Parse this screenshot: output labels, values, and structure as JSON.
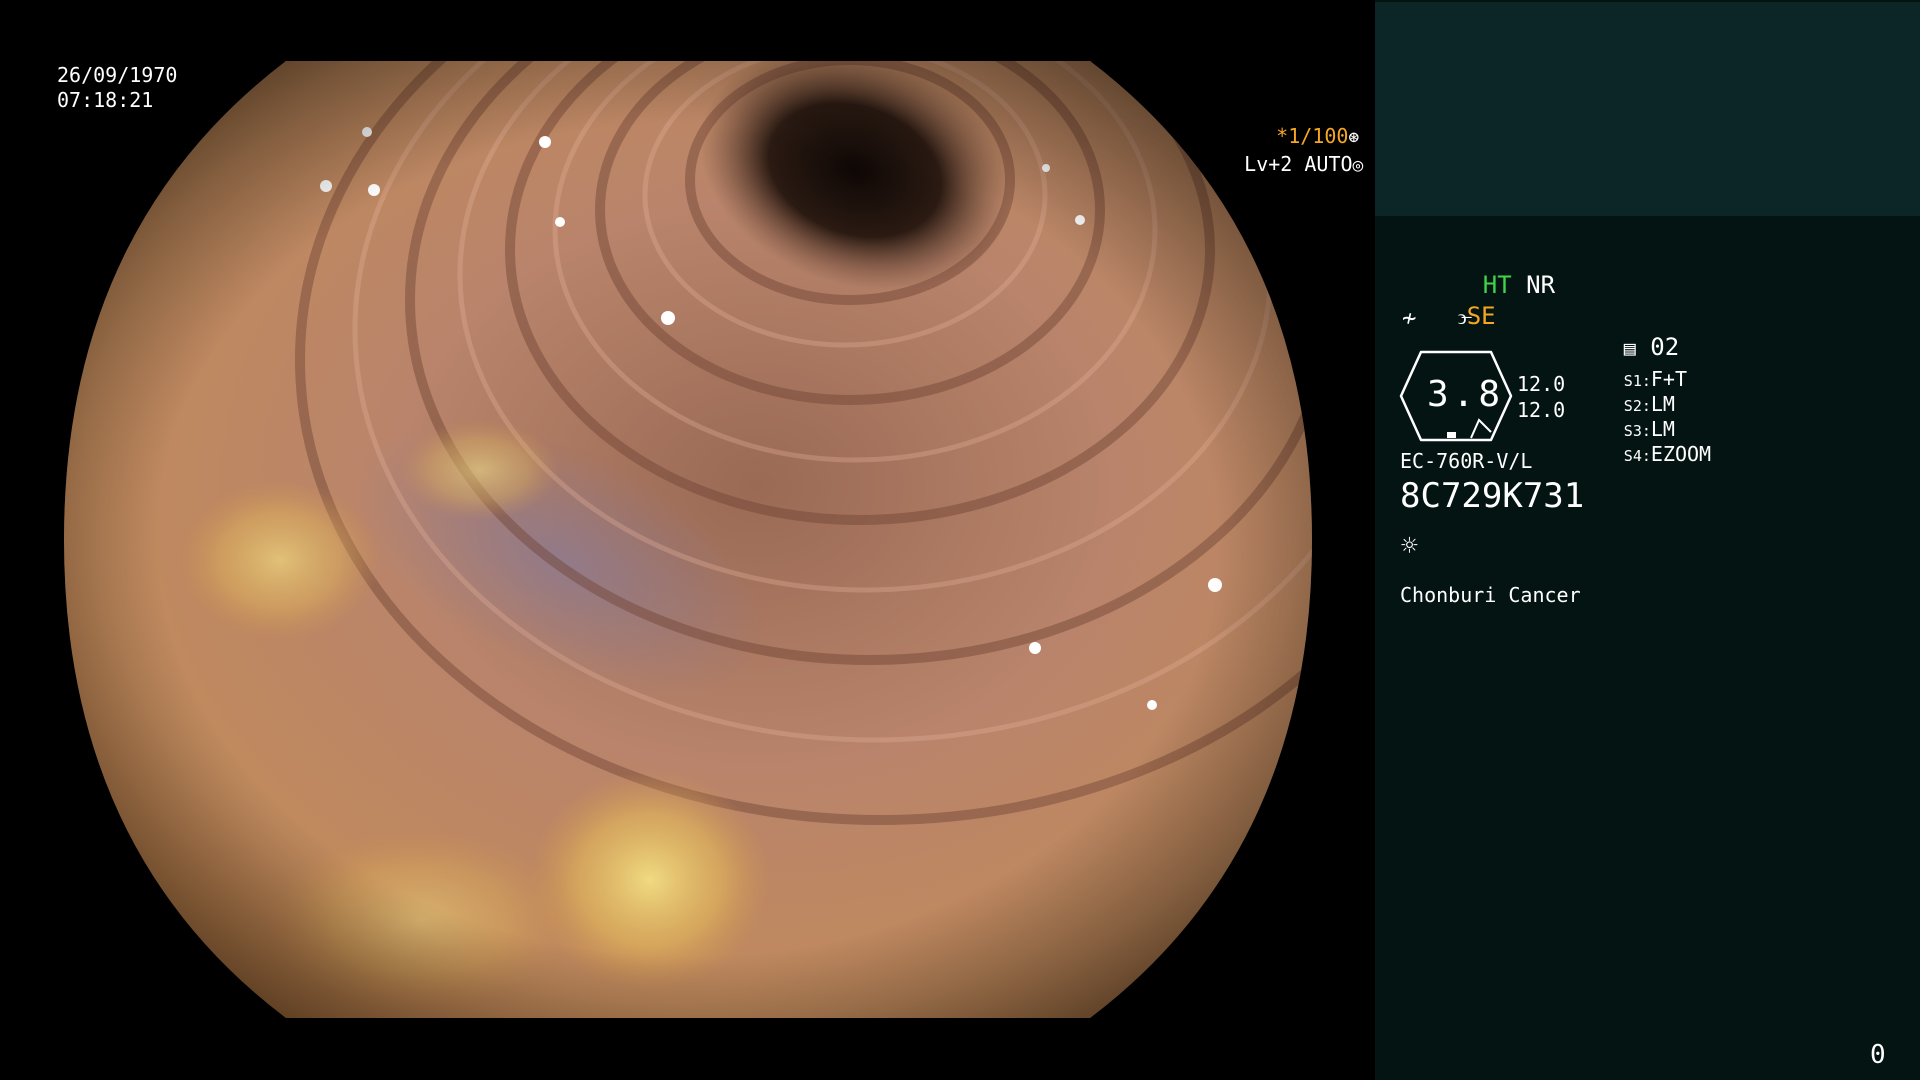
{
  "overlay": {
    "date": "26/09/1970",
    "time": "07:18:21",
    "shutter": "*1/100",
    "shutter_icon": "shutter-icon",
    "iris": "Lv+2 AUTO",
    "iris_icon": "iris-icon"
  },
  "panel": {
    "modes": {
      "ht": "HT",
      "nr": "NR",
      "se": "SE",
      "se_icon": "structure-enhance-icon",
      "color_icon": "color-curve-icon"
    },
    "record_icon": "record-icon",
    "record_count": "02",
    "zoom": {
      "value": "3.8",
      "top_scale": "12.0",
      "bottom_scale": "12.0"
    },
    "switches": [
      {
        "key": "S1:",
        "value": "F+T"
      },
      {
        "key": "S2:",
        "value": "LM"
      },
      {
        "key": "S3:",
        "value": "LM"
      },
      {
        "key": "S4:",
        "value": "EZOOM"
      }
    ],
    "scope_model": "EC-760R-V/L",
    "serial": "8C729K731",
    "light_icon": "light-icon",
    "institution": "Chonburi Cancer",
    "counter": "0"
  },
  "colors": {
    "accent_orange": "#f5a623",
    "accent_green": "#3fd44a",
    "panel_bg": "#041412",
    "thumb_bg": "#0c2628"
  }
}
